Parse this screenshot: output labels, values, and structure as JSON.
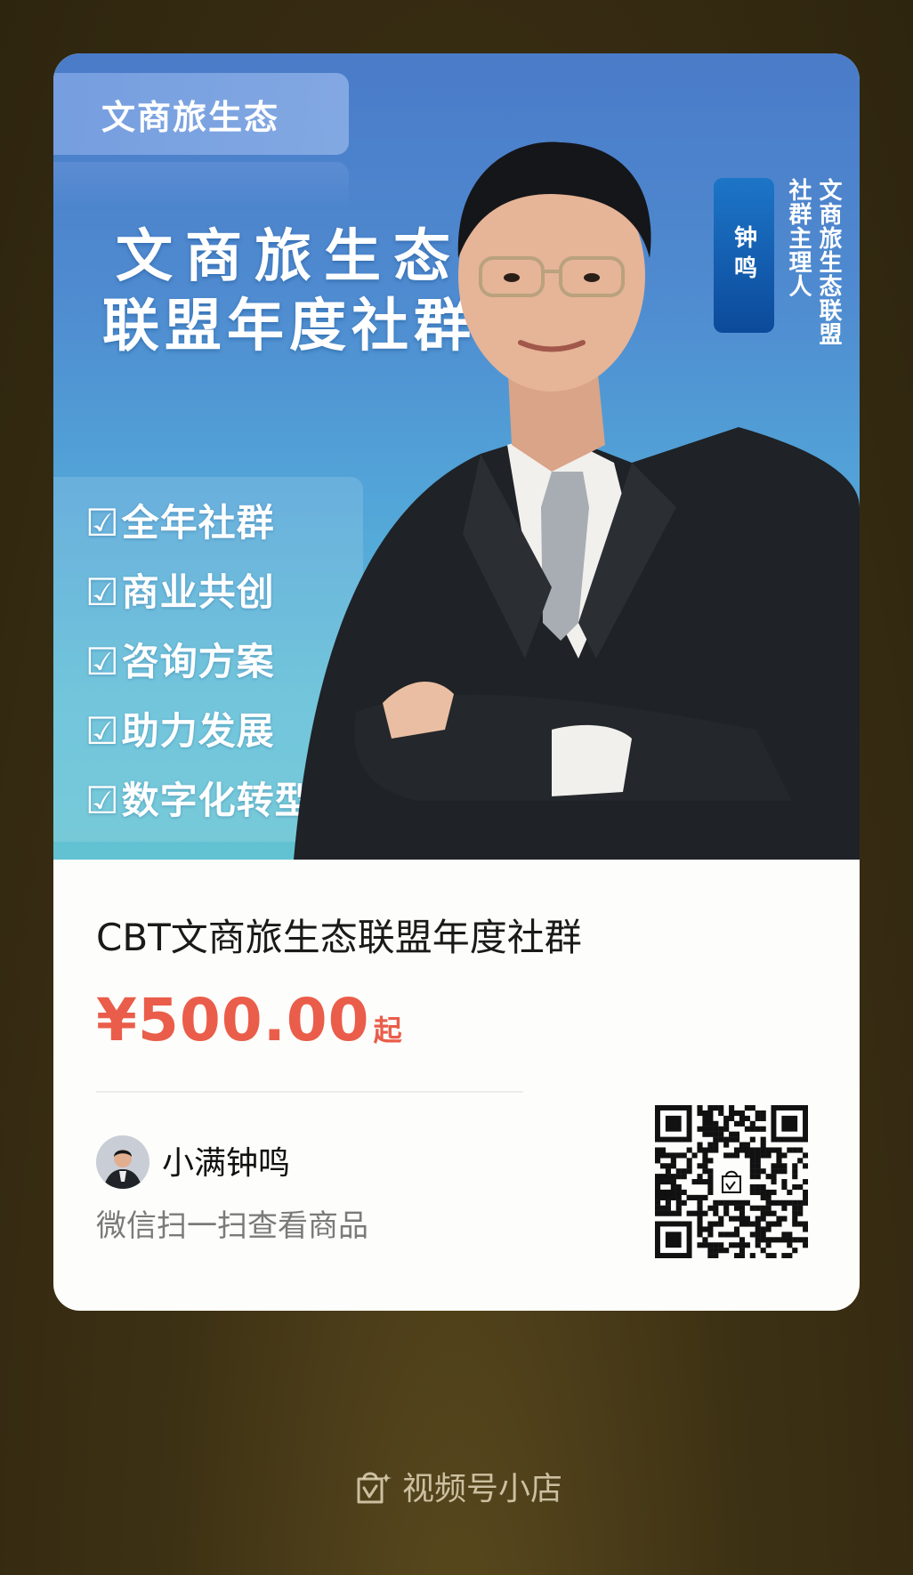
{
  "poster": {
    "tag_label": "文商旅生态",
    "headline_line1": "文商旅生态",
    "headline_line2": "联盟年度社群",
    "checklist": [
      "全年社群",
      "商业共创",
      "咨询方案",
      "助力发展",
      "数字化转型"
    ],
    "checkbox_glyph": "☑",
    "badge_name": "钟鸣",
    "vertical_title_1": "社群主理人",
    "vertical_title_2": "文商旅生态联盟"
  },
  "product": {
    "title": "CBT文商旅生态联盟年度社群",
    "price": "¥500.00",
    "price_suffix": "起"
  },
  "seller": {
    "name": "小满钟鸣",
    "scan_hint": "微信扫一扫查看商品"
  },
  "footer": {
    "label": "视频号小店",
    "icon": "shop-bag-icon"
  },
  "colors": {
    "price": "#ea5d4a",
    "background": "#3d3114",
    "poster_blue": "#4f8bd0"
  }
}
